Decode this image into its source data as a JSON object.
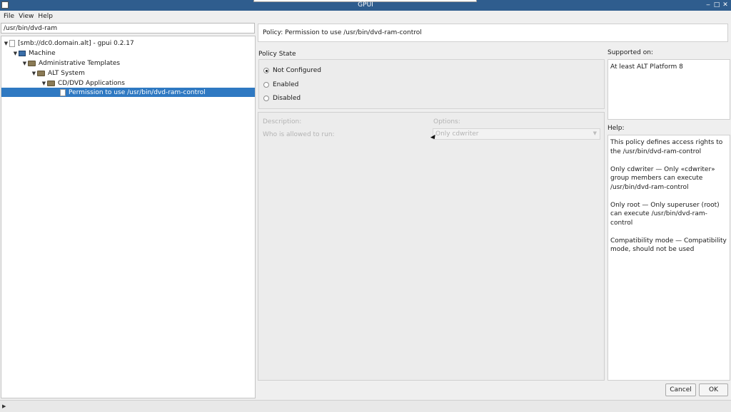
{
  "window": {
    "title": "GPUI"
  },
  "menu": [
    "File",
    "View",
    "Help"
  ],
  "search": {
    "value": "/usr/bin/dvd-ram"
  },
  "tree": [
    {
      "label": "[smb://dc0.domain.alt] - gpui 0.2.17",
      "icon": "file-icon",
      "expanded": true
    },
    {
      "label": "Machine",
      "icon": "computer-icon",
      "expanded": true
    },
    {
      "label": "Administrative Templates",
      "icon": "folder-icon",
      "expanded": true
    },
    {
      "label": "ALT System",
      "icon": "folder-icon",
      "expanded": true
    },
    {
      "label": "CD/DVD Applications",
      "icon": "folder-icon",
      "expanded": true
    },
    {
      "label": "Permission to use /usr/bin/dvd-ram-control",
      "icon": "document-icon",
      "selected": true
    }
  ],
  "policy": {
    "header": "Policy: Permission to use /usr/bin/dvd-ram-control",
    "state_label": "Policy State",
    "states": [
      "Not Configured",
      "Enabled",
      "Disabled"
    ],
    "selected_state": "Not Configured",
    "description_label": "Description:",
    "options_label": "Options:",
    "option_name": "Who is allowed to run:",
    "option_value": "Only cdwriter",
    "supported_label": "Supported on:",
    "supported_value": "At least ALT Platform 8",
    "help_label": "Help:",
    "help_paragraphs": [
      "This policy defines access rights to the /usr/bin/dvd-ram-control",
      "Only cdwriter — Only «cdwriter» group members can execute /usr/bin/dvd-ram-control",
      "Only root — Only superuser (root) can execute /usr/bin/dvd-ram-control",
      "Compatibility mode — Compatibility mode, should not be used"
    ]
  },
  "buttons": {
    "cancel": "Cancel",
    "ok": "OK"
  },
  "colors": {
    "titlebar": "#2f5d8e",
    "selection": "#2f79c2"
  }
}
